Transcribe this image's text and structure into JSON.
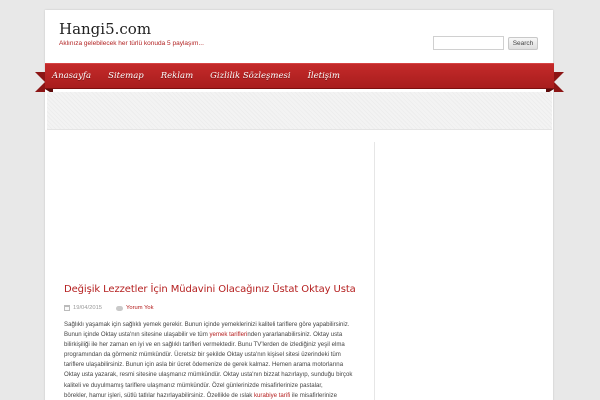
{
  "header": {
    "site_title": "Hangi5.com",
    "tagline": "Aklınıza gelebilecek her türlü konuda 5 paylaşım...",
    "search_placeholder": "",
    "search_button": "Search"
  },
  "nav": {
    "items": [
      "Anasayfa",
      "Sitemap",
      "Reklam",
      "Gizlilik Sözleşmesi",
      "İletişim"
    ]
  },
  "post": {
    "title": "Değişik Lezzetler İçin Müdavini Olacağınız Üstat Oktay Usta",
    "date": "19/04/2015",
    "comments": "Yorum Yok",
    "lines": [
      [
        "Sağlıklı yaşamak için sağlıklı yemek gerekir. Bunun içinde yemeklerinizi kaliteli tariflere göre yapabilirsiniz."
      ],
      [
        "Bunun içinde Oktay usta'nın sitesine ulaşabilir ve tüm ",
        "yemek tarifleri",
        "nden yararlanabilirsiniz. Oktay usta"
      ],
      [
        "bilirkişiliği ile her zaman en iyi ve en sağlıklı tarifleri vermektedir. Bunu TV'lerden de izlediğiniz yeşil elma"
      ],
      [
        "programından da görmeniz mümkündür. Ücretsiz bir şekilde Oktay usta'nın kişisel sitesi üzerindeki tüm"
      ],
      [
        "tariflere ulaşabilirsiniz. Bunun için asla bir ücret ödemenize de gerek kalmaz. Hemen arama motorlarına"
      ],
      [
        "Oktay usta yazarak, resmi sitesine ulaşmanız mümkündür. Oktay usta'nın bizzat hazırlayıp, sunduğu birçok"
      ],
      [
        "kaliteli ve duyulmamış tariflere ulaşmanız mümkündür. Özel günlerinizde misafirlerinize pastalar,"
      ],
      [
        "börekler, hamur işleri, sütlü tatlılar hazırlayabilirsiniz. Özellikle de ıslak ",
        "kurabiye tarifi",
        " ile misafirlerinize"
      ]
    ]
  },
  "colors": {
    "accent": "#b52020",
    "ribbon": "#b52424",
    "background": "#e8e8e8"
  },
  "icons": [
    "calendar-icon",
    "comment-icon"
  ]
}
